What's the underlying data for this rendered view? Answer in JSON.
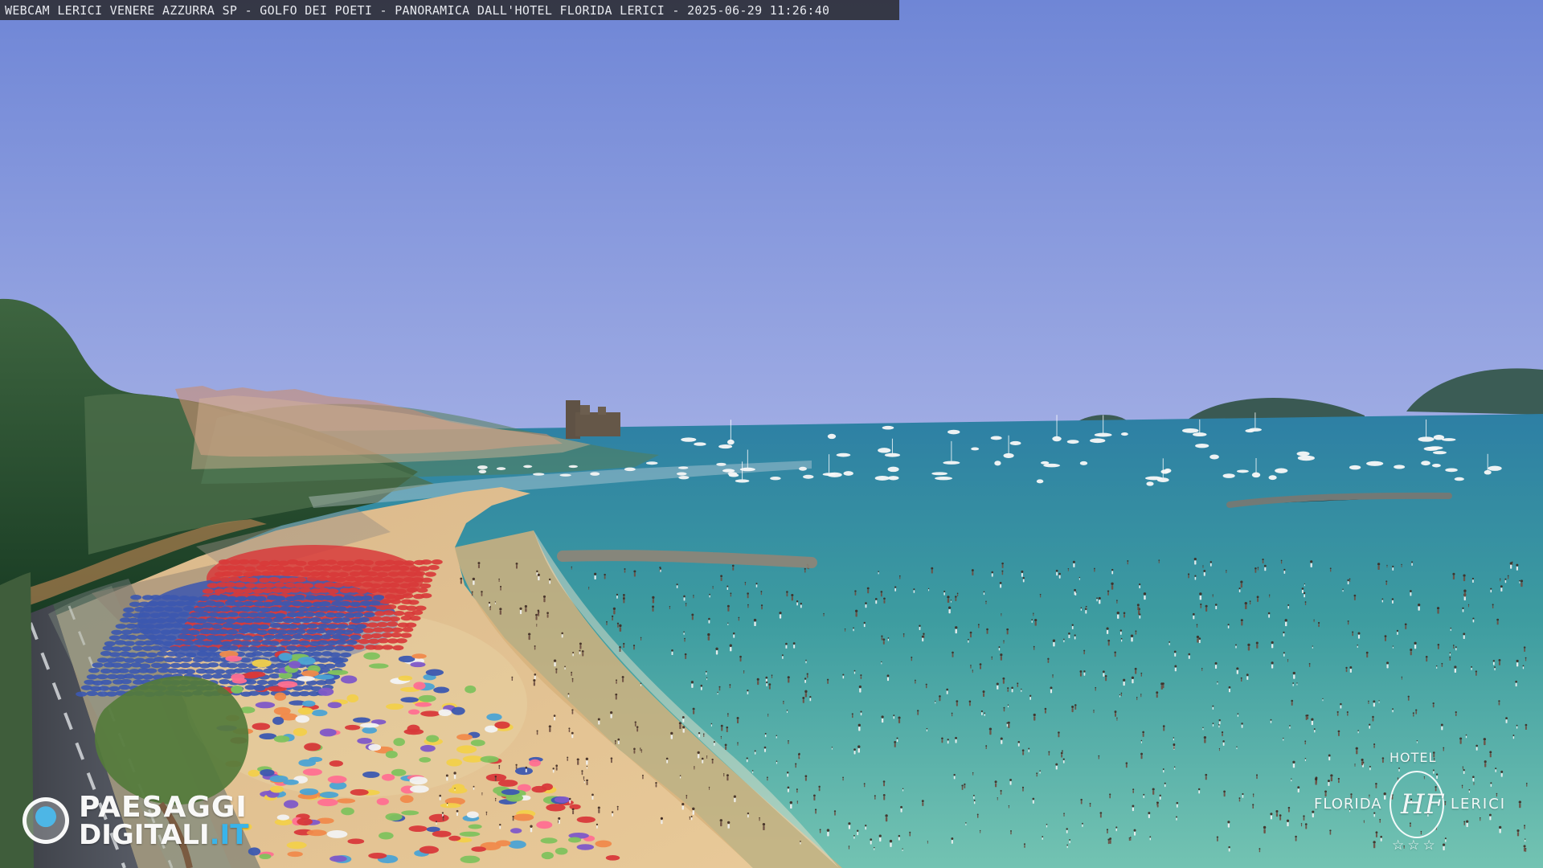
{
  "overlay": {
    "caption": "WEBCAM LERICI VENERE AZZURRA SP - GOLFO DEI POETI - PANORAMICA DALL'HOTEL FLORIDA LERICI - 2025-06-29 11:26:40"
  },
  "branding": {
    "paesaggi_line1": "PAESAGGI",
    "paesaggi_line2_main": "DIGITALI",
    "paesaggi_line2_suffix": ".IT",
    "hotel_top": "HOTEL",
    "hotel_left": "FLORIDA",
    "hotel_right": "LERICI",
    "hotel_monogram": "HF",
    "hotel_stars": "☆☆☆"
  },
  "colors": {
    "sky_top": "#6f86d6",
    "sky_bottom": "#e0dbef",
    "sea_deep": "#2d7fa4",
    "sea_mid": "#3d9ca0",
    "sea_shallow": "#73c3b2",
    "sand": "#e3c491",
    "shore": "#d7b27c",
    "hill_green": "#234c2a",
    "town_roof": "#c98d72",
    "castle": "#5f5245",
    "road": "#454952",
    "umbrella_red": "#d8393a",
    "umbrella_blue": "#3c58b0",
    "accent_blue": "#39b4ea"
  },
  "icons": {
    "left_logo": "paesaggi-digitali-logo",
    "right_logo": "hotel-florida-logo"
  }
}
